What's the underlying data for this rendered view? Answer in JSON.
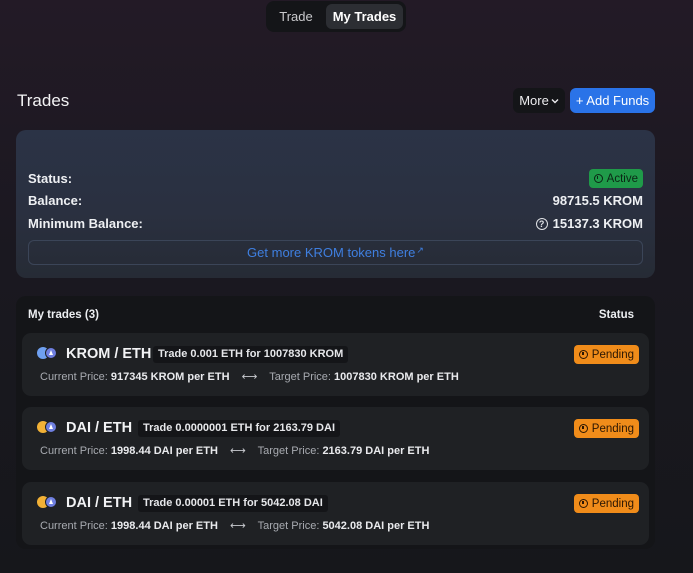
{
  "tabs": [
    {
      "label": "Trade",
      "active": false
    },
    {
      "label": "My Trades",
      "active": true
    }
  ],
  "header": {
    "title": "Trades",
    "more_label": "More",
    "add_funds_label": "+ Add Funds"
  },
  "account": {
    "status_label": "Status:",
    "status_value": "Active",
    "balance_label": "Balance:",
    "balance_value": "98715.5 KROM",
    "min_balance_label": "Minimum Balance:",
    "min_balance_value": "15137.3 KROM",
    "get_more_label": "Get more KROM tokens here",
    "get_more_arrow": "↗"
  },
  "trades_panel": {
    "title": "My trades (3)",
    "status_header": "Status"
  },
  "trades": [
    {
      "pair": "KROM / ETH",
      "base_icon": "krom-token-icon",
      "quote_icon": "eth-token-icon",
      "description": "Trade 0.001 ETH for 1007830 KROM",
      "status": "Pending",
      "current_label": "Current Price:",
      "current_value": "917345 KROM per ETH",
      "swap_icon": "⟷",
      "target_label": "Target Price:",
      "target_value": "1007830 KROM per ETH"
    },
    {
      "pair": "DAI / ETH",
      "base_icon": "dai-token-icon",
      "quote_icon": "eth-token-icon",
      "description": "Trade 0.0000001 ETH for 2163.79 DAI",
      "status": "Pending",
      "current_label": "Current Price:",
      "current_value": "1998.44 DAI per ETH",
      "swap_icon": "⟷",
      "target_label": "Target Price:",
      "target_value": "2163.79 DAI per ETH"
    },
    {
      "pair": "DAI / ETH",
      "base_icon": "dai-token-icon",
      "quote_icon": "eth-token-icon",
      "description": "Trade 0.00001 ETH for 5042.08 DAI",
      "status": "Pending",
      "current_label": "Current Price:",
      "current_value": "1998.44 DAI per ETH",
      "swap_icon": "⟷",
      "target_label": "Target Price:",
      "target_value": "5042.08 DAI per ETH"
    }
  ],
  "colors": {
    "accent_blue": "#2a73e8",
    "active_green": "#1f9a49",
    "pending_orange": "#f08c1a",
    "krom_icon": "#6fa0f0",
    "dai_icon": "#f2b136",
    "eth_icon": "#6f7fe0"
  }
}
